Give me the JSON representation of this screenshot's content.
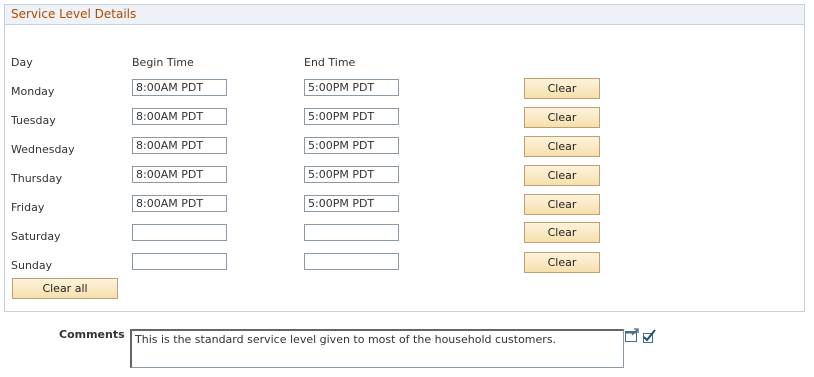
{
  "panel": {
    "title": "Service Level Details"
  },
  "columns": {
    "day": "Day",
    "begin": "Begin Time",
    "end": "End Time"
  },
  "days": [
    {
      "day": "Monday",
      "begin": "8:00AM PDT",
      "end": "5:00PM PDT",
      "clear_label": "Clear"
    },
    {
      "day": "Tuesday",
      "begin": "8:00AM PDT",
      "end": "5:00PM PDT",
      "clear_label": "Clear"
    },
    {
      "day": "Wednesday",
      "begin": "8:00AM PDT",
      "end": "5:00PM PDT",
      "clear_label": "Clear"
    },
    {
      "day": "Thursday",
      "begin": "8:00AM PDT",
      "end": "5:00PM PDT",
      "clear_label": "Clear"
    },
    {
      "day": "Friday",
      "begin": "8:00AM PDT",
      "end": "5:00PM PDT",
      "clear_label": "Clear"
    },
    {
      "day": "Saturday",
      "begin": "",
      "end": "",
      "clear_label": "Clear"
    },
    {
      "day": "Sunday",
      "begin": "",
      "end": "",
      "clear_label": "Clear"
    }
  ],
  "clear_all_label": "Clear all",
  "comments": {
    "label": "Comments",
    "value": "This is the standard service level given to most of the household customers."
  },
  "icons": {
    "expand": "expand-textarea-icon",
    "spellcheck": "spell-check-icon"
  },
  "colors": {
    "title": "#b04a00",
    "header_bg": "#eef1f5",
    "border": "#c5d1de",
    "button_bg": "#f6dfac",
    "button_border": "#c0a070"
  }
}
